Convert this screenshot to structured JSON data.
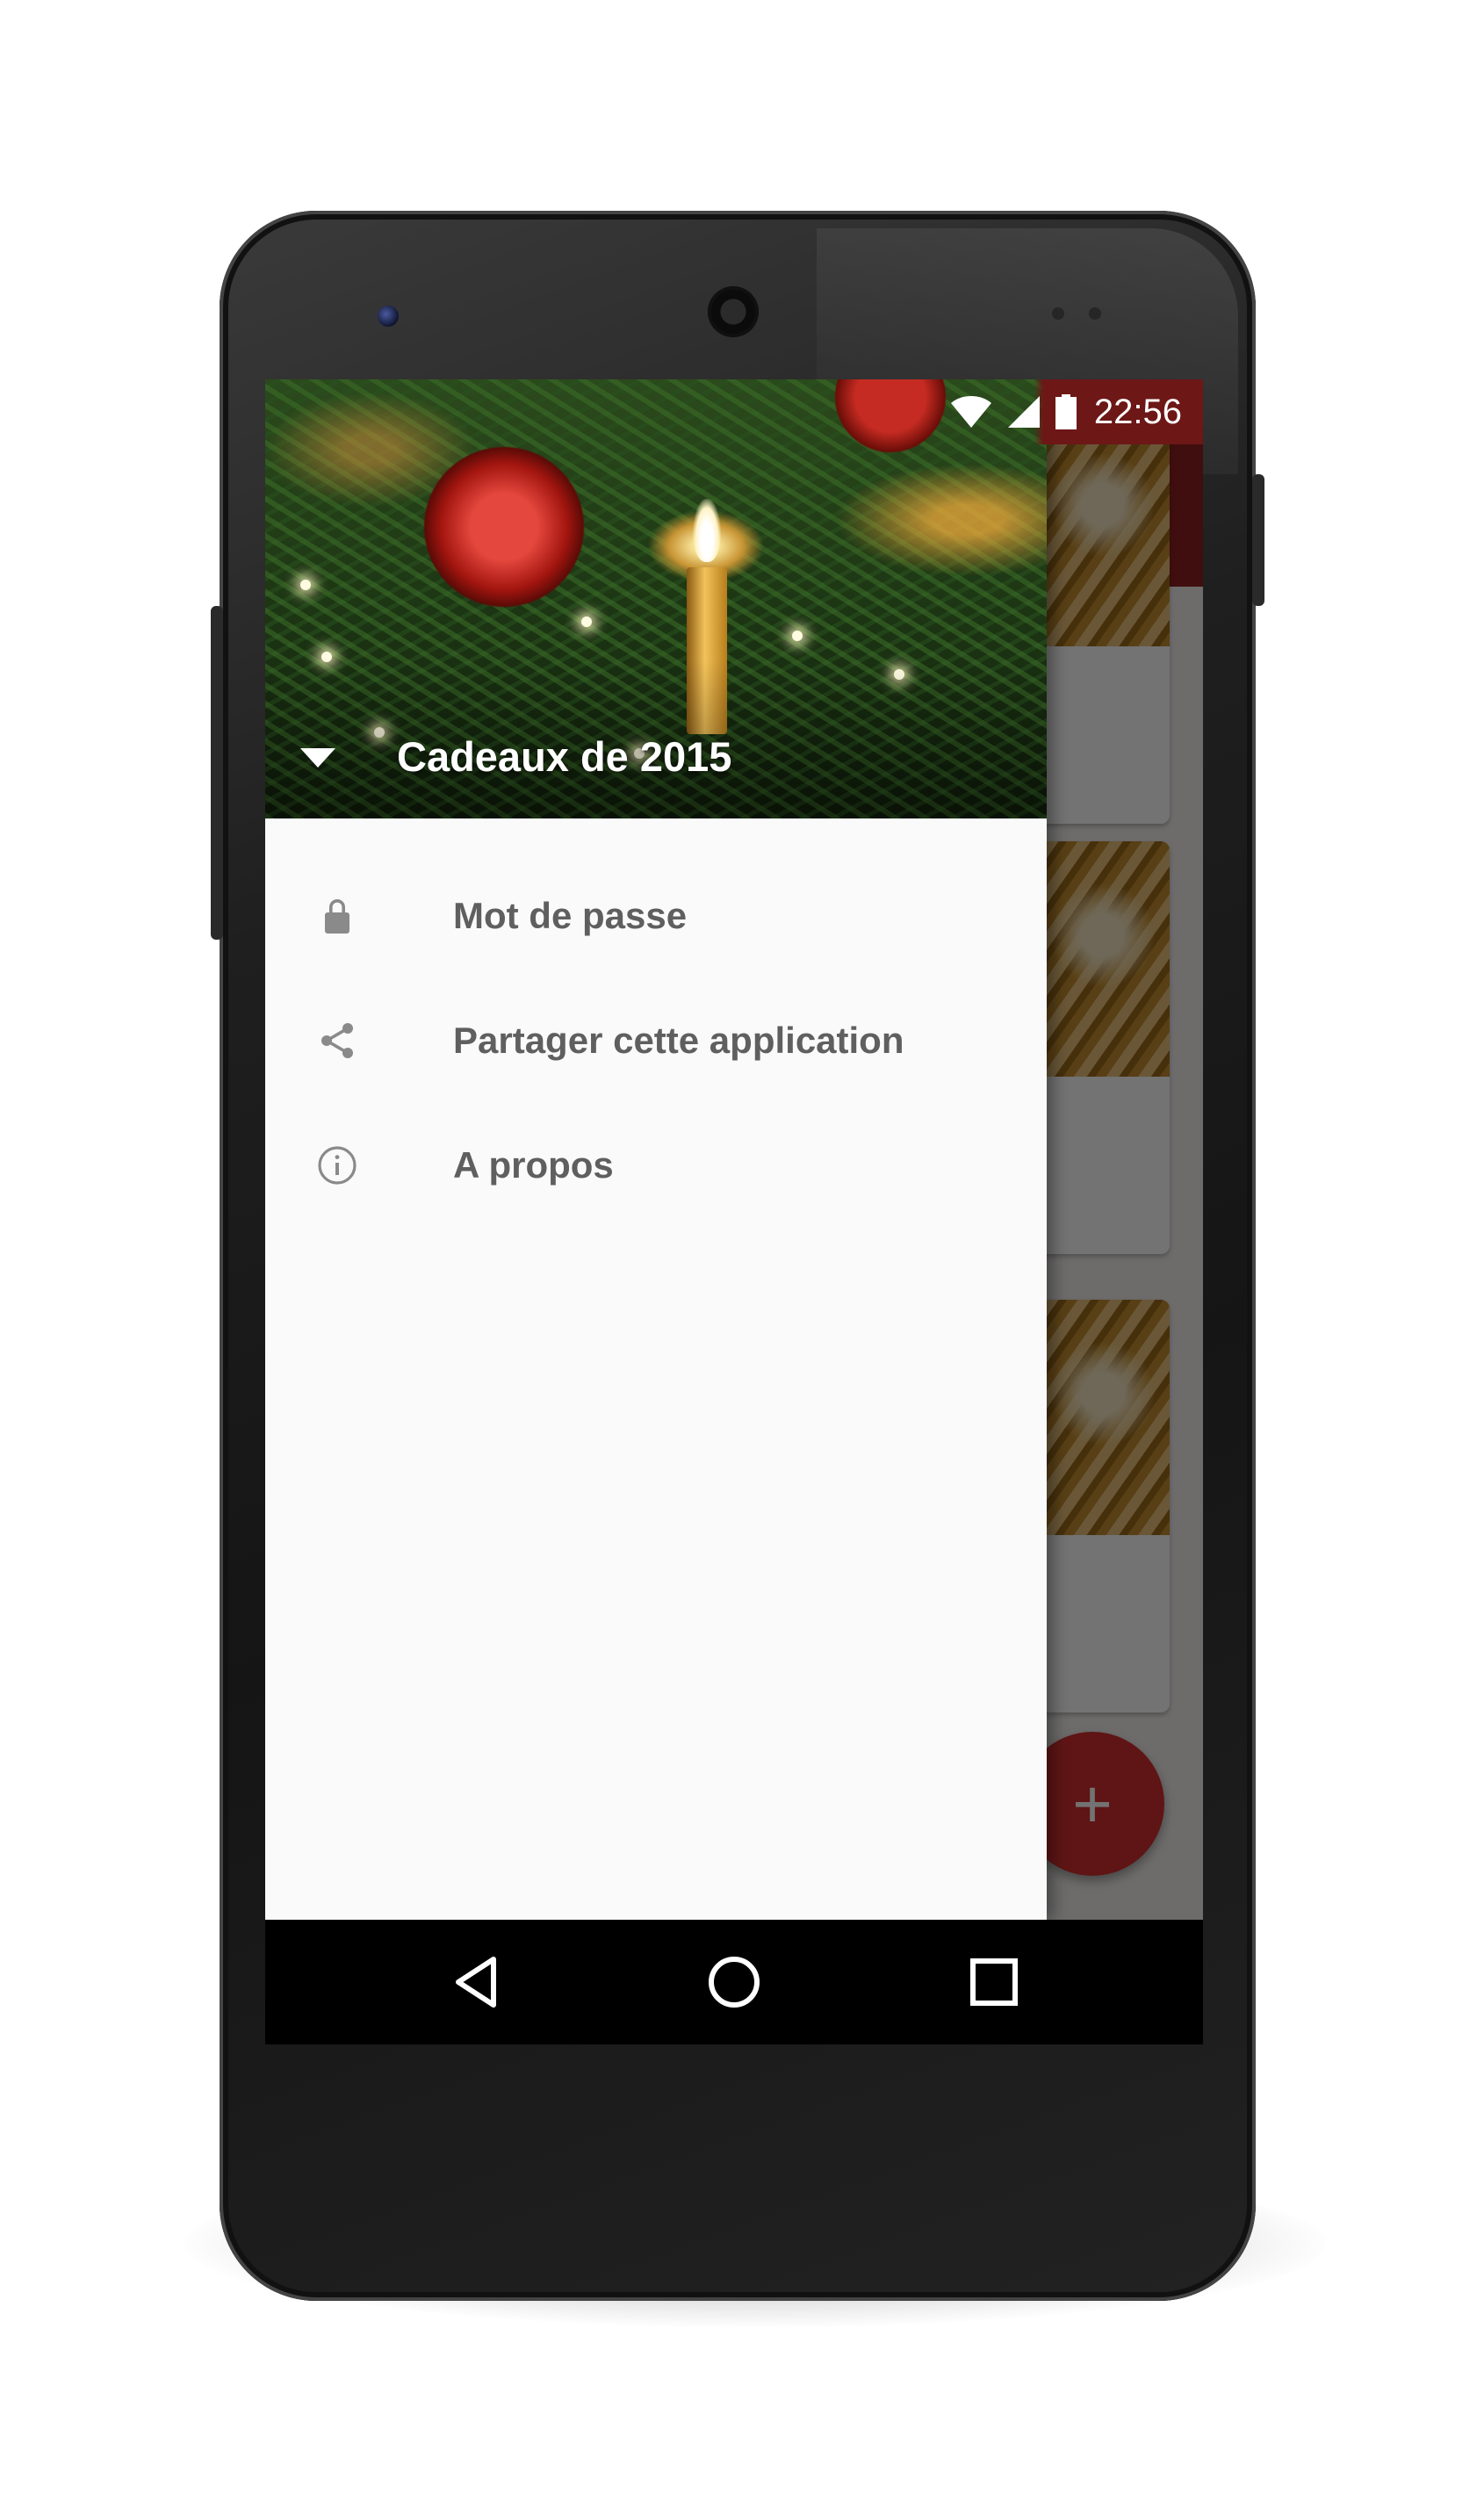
{
  "status_bar": {
    "time": "22:56",
    "icons": [
      "wifi-icon",
      "signal-icon",
      "battery-icon"
    ]
  },
  "drawer": {
    "header_title": "Cadeaux de 2015",
    "header_toggle_icon": "dropdown-arrow-icon",
    "items": [
      {
        "icon": "lock-icon",
        "label": "Mot de passe"
      },
      {
        "icon": "share-icon",
        "label": "Partager cette application"
      },
      {
        "icon": "info-icon",
        "label": "A propos"
      }
    ]
  },
  "background_app": {
    "toolbar_color": "#8e1f1f",
    "fab_label": "+",
    "fab_color": "#d32f2f",
    "card_checked_states": [
      false,
      false,
      true
    ]
  },
  "nav_bar": {
    "buttons": [
      "back-icon",
      "home-icon",
      "recent-apps-icon"
    ]
  }
}
